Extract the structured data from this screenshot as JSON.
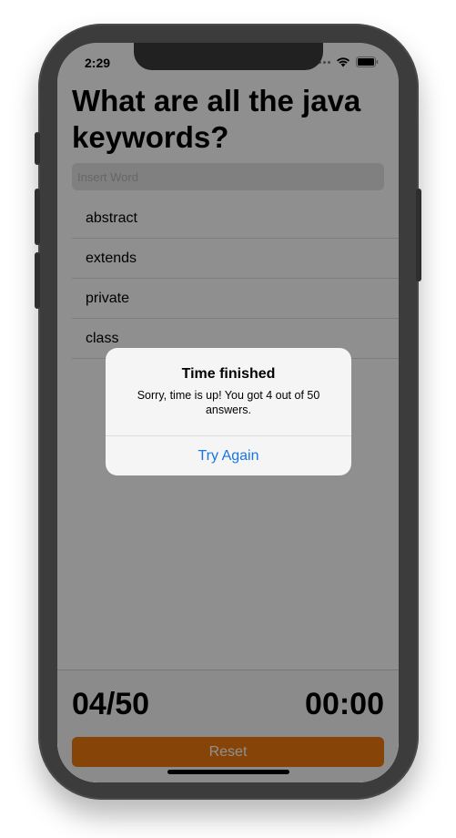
{
  "status": {
    "time": "2:29"
  },
  "quiz": {
    "title": "What are all the java keywords?",
    "input_placeholder": "Insert Word",
    "answers": [
      "abstract",
      "extends",
      "private",
      "class"
    ]
  },
  "footer": {
    "score": "04/50",
    "timer": "00:00",
    "reset_label": "Reset"
  },
  "alert": {
    "title": "Time finished",
    "message": "Sorry, time is up! You got 4 out of 50 answers.",
    "action_label": "Try Again"
  },
  "icons": {
    "signal": "signal-dots-icon",
    "wifi": "wifi-icon",
    "battery": "battery-icon"
  },
  "colors": {
    "accent": "#f07a0f",
    "link": "#1676e6"
  }
}
